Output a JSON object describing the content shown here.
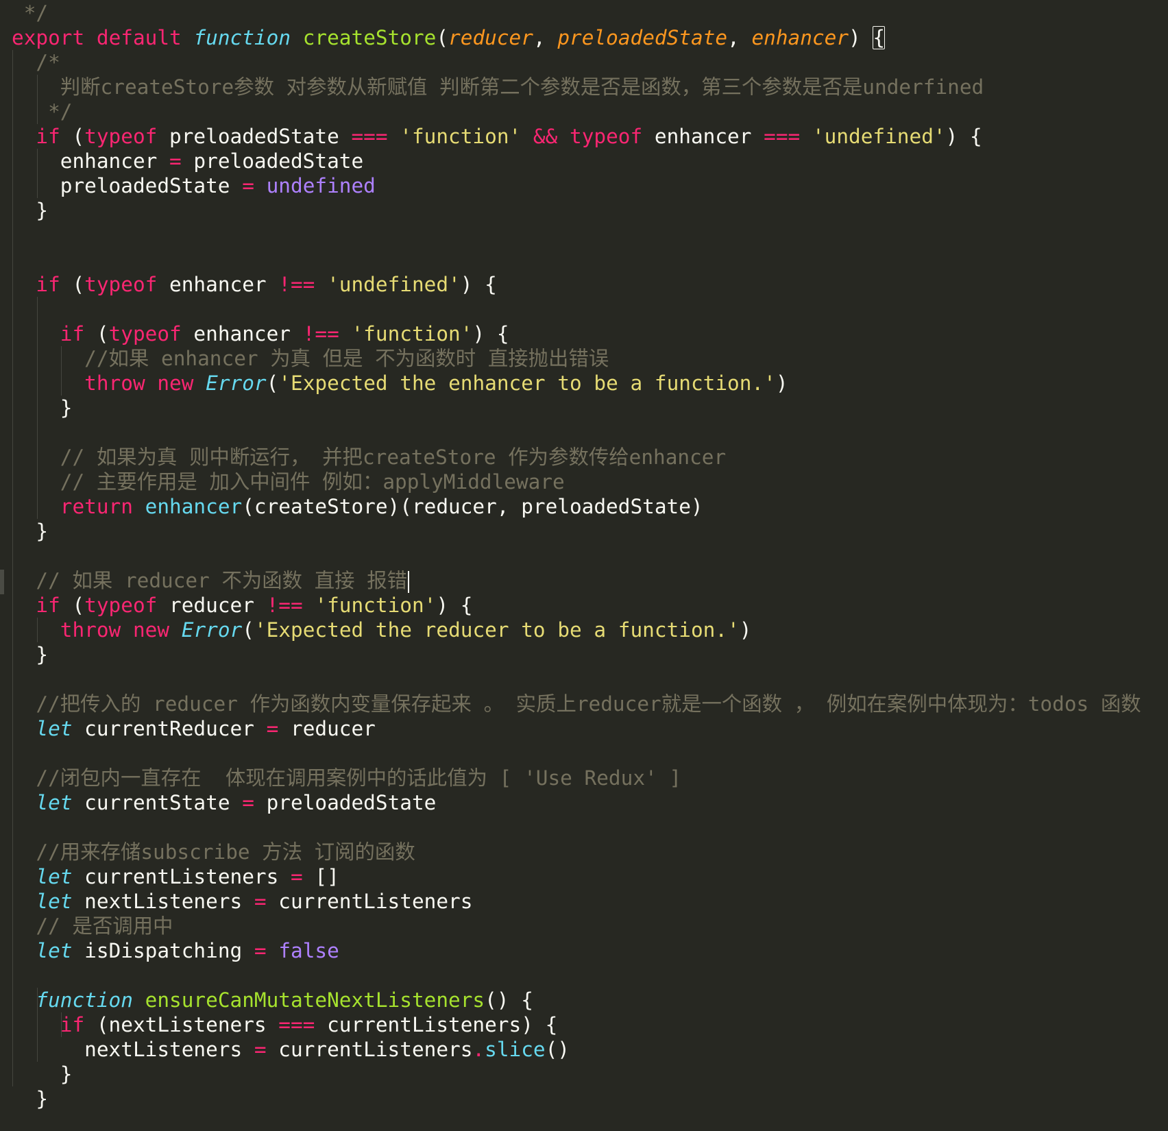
{
  "editor": {
    "theme": "Monokai",
    "colors": {
      "background": "#272822",
      "keyword": "#f92672",
      "storage": "#66d9ef",
      "function_name": "#a6e22e",
      "parameter": "#fd971f",
      "string": "#e6db74",
      "comment": "#75715e",
      "constant": "#ae81ff",
      "text": "#f8f8f2"
    },
    "cursor_line": 24,
    "lines": [
      [
        {
          "t": " */",
          "c": "comment"
        }
      ],
      [
        {
          "t": "export",
          "c": "keyword"
        },
        {
          "t": " ",
          "c": "plain"
        },
        {
          "t": "default",
          "c": "keyword"
        },
        {
          "t": " ",
          "c": "plain"
        },
        {
          "t": "function",
          "c": "storage"
        },
        {
          "t": " ",
          "c": "plain"
        },
        {
          "t": "createStore",
          "c": "funcname"
        },
        {
          "t": "(",
          "c": "plain"
        },
        {
          "t": "reducer",
          "c": "param"
        },
        {
          "t": ", ",
          "c": "plain"
        },
        {
          "t": "preloadedState",
          "c": "param"
        },
        {
          "t": ", ",
          "c": "plain"
        },
        {
          "t": "enhancer",
          "c": "param"
        },
        {
          "t": ") ",
          "c": "plain"
        },
        {
          "t": "{",
          "c": "plain",
          "m": "bracket"
        }
      ],
      [
        {
          "t": "  /*",
          "c": "comment"
        }
      ],
      [
        {
          "t": "    判断createStore参数 对参数从新赋值 判断第二个参数是否是函数，第三个参数是否是underfined",
          "c": "comment"
        }
      ],
      [
        {
          "t": "   */",
          "c": "comment"
        }
      ],
      [
        {
          "t": "  ",
          "c": "plain"
        },
        {
          "t": "if",
          "c": "keyword"
        },
        {
          "t": " (",
          "c": "plain"
        },
        {
          "t": "typeof",
          "c": "keyword"
        },
        {
          "t": " preloadedState ",
          "c": "plain"
        },
        {
          "t": "===",
          "c": "op"
        },
        {
          "t": " ",
          "c": "plain"
        },
        {
          "t": "'function'",
          "c": "string"
        },
        {
          "t": " ",
          "c": "plain"
        },
        {
          "t": "&&",
          "c": "op"
        },
        {
          "t": " ",
          "c": "plain"
        },
        {
          "t": "typeof",
          "c": "keyword"
        },
        {
          "t": " enhancer ",
          "c": "plain"
        },
        {
          "t": "===",
          "c": "op"
        },
        {
          "t": " ",
          "c": "plain"
        },
        {
          "t": "'undefined'",
          "c": "string"
        },
        {
          "t": ") {",
          "c": "plain"
        }
      ],
      [
        {
          "t": "    enhancer ",
          "c": "plain"
        },
        {
          "t": "=",
          "c": "op"
        },
        {
          "t": " preloadedState",
          "c": "plain"
        }
      ],
      [
        {
          "t": "    preloadedState ",
          "c": "plain"
        },
        {
          "t": "=",
          "c": "op"
        },
        {
          "t": " ",
          "c": "plain"
        },
        {
          "t": "undefined",
          "c": "constant"
        }
      ],
      [
        {
          "t": "  }",
          "c": "plain"
        }
      ],
      [],
      [],
      [
        {
          "t": "  ",
          "c": "plain"
        },
        {
          "t": "if",
          "c": "keyword"
        },
        {
          "t": " (",
          "c": "plain"
        },
        {
          "t": "typeof",
          "c": "keyword"
        },
        {
          "t": " enhancer ",
          "c": "plain"
        },
        {
          "t": "!==",
          "c": "op"
        },
        {
          "t": " ",
          "c": "plain"
        },
        {
          "t": "'undefined'",
          "c": "string"
        },
        {
          "t": ") {",
          "c": "plain"
        }
      ],
      [],
      [
        {
          "t": "    ",
          "c": "plain"
        },
        {
          "t": "if",
          "c": "keyword"
        },
        {
          "t": " (",
          "c": "plain"
        },
        {
          "t": "typeof",
          "c": "keyword"
        },
        {
          "t": " enhancer ",
          "c": "plain"
        },
        {
          "t": "!==",
          "c": "op"
        },
        {
          "t": " ",
          "c": "plain"
        },
        {
          "t": "'function'",
          "c": "string"
        },
        {
          "t": ") {",
          "c": "plain"
        }
      ],
      [
        {
          "t": "      //如果 enhancer 为真 但是 不为函数时 直接抛出错误",
          "c": "comment"
        }
      ],
      [
        {
          "t": "      ",
          "c": "plain"
        },
        {
          "t": "throw",
          "c": "keyword"
        },
        {
          "t": " ",
          "c": "plain"
        },
        {
          "t": "new",
          "c": "keyword"
        },
        {
          "t": " ",
          "c": "plain"
        },
        {
          "t": "Error",
          "c": "type"
        },
        {
          "t": "(",
          "c": "plain"
        },
        {
          "t": "'Expected the enhancer to be a function.'",
          "c": "string"
        },
        {
          "t": ")",
          "c": "plain"
        }
      ],
      [
        {
          "t": "    }",
          "c": "plain"
        }
      ],
      [],
      [
        {
          "t": "    // 如果为真 则中断运行， 并把createStore 作为参数传给enhancer",
          "c": "comment"
        }
      ],
      [
        {
          "t": "    // 主要作用是 加入中间件 例如：applyMiddleware",
          "c": "comment"
        }
      ],
      [
        {
          "t": "    ",
          "c": "plain"
        },
        {
          "t": "return",
          "c": "keyword"
        },
        {
          "t": " ",
          "c": "plain"
        },
        {
          "t": "enhancer",
          "c": "support"
        },
        {
          "t": "(createStore)(reducer, preloadedState)",
          "c": "plain"
        }
      ],
      [
        {
          "t": "  }",
          "c": "plain"
        }
      ],
      [],
      [
        {
          "t": "  // 如果 reducer 不为函数 直接 报错",
          "c": "comment"
        },
        {
          "t": "",
          "c": "plain",
          "m": "cursor"
        }
      ],
      [
        {
          "t": "  ",
          "c": "plain"
        },
        {
          "t": "if",
          "c": "keyword"
        },
        {
          "t": " (",
          "c": "plain"
        },
        {
          "t": "typeof",
          "c": "keyword"
        },
        {
          "t": " reducer ",
          "c": "plain"
        },
        {
          "t": "!==",
          "c": "op"
        },
        {
          "t": " ",
          "c": "plain"
        },
        {
          "t": "'function'",
          "c": "string"
        },
        {
          "t": ") {",
          "c": "plain"
        }
      ],
      [
        {
          "t": "    ",
          "c": "plain"
        },
        {
          "t": "throw",
          "c": "keyword"
        },
        {
          "t": " ",
          "c": "plain"
        },
        {
          "t": "new",
          "c": "keyword"
        },
        {
          "t": " ",
          "c": "plain"
        },
        {
          "t": "Error",
          "c": "type"
        },
        {
          "t": "(",
          "c": "plain"
        },
        {
          "t": "'Expected the reducer to be a function.'",
          "c": "string"
        },
        {
          "t": ")",
          "c": "plain"
        }
      ],
      [
        {
          "t": "  }",
          "c": "plain"
        }
      ],
      [],
      [
        {
          "t": "  //把传入的 reducer 作为函数内变量保存起来 。 实质上reducer就是一个函数 ， 例如在案例中体现为：todos 函数",
          "c": "comment"
        }
      ],
      [
        {
          "t": "  ",
          "c": "plain"
        },
        {
          "t": "let",
          "c": "storage"
        },
        {
          "t": " currentReducer ",
          "c": "plain"
        },
        {
          "t": "=",
          "c": "op"
        },
        {
          "t": " reducer",
          "c": "plain"
        }
      ],
      [],
      [
        {
          "t": "  //闭包内一直存在  体现在调用案例中的话此值为 [ 'Use Redux' ]",
          "c": "comment"
        }
      ],
      [
        {
          "t": "  ",
          "c": "plain"
        },
        {
          "t": "let",
          "c": "storage"
        },
        {
          "t": " currentState ",
          "c": "plain"
        },
        {
          "t": "=",
          "c": "op"
        },
        {
          "t": " preloadedState",
          "c": "plain"
        }
      ],
      [],
      [
        {
          "t": "  //用来存储subscribe 方法 订阅的函数",
          "c": "comment"
        }
      ],
      [
        {
          "t": "  ",
          "c": "plain"
        },
        {
          "t": "let",
          "c": "storage"
        },
        {
          "t": " currentListeners ",
          "c": "plain"
        },
        {
          "t": "=",
          "c": "op"
        },
        {
          "t": " []",
          "c": "plain"
        }
      ],
      [
        {
          "t": "  ",
          "c": "plain"
        },
        {
          "t": "let",
          "c": "storage"
        },
        {
          "t": " nextListeners ",
          "c": "plain"
        },
        {
          "t": "=",
          "c": "op"
        },
        {
          "t": " currentListeners",
          "c": "plain"
        }
      ],
      [
        {
          "t": "  // 是否调用中",
          "c": "comment"
        }
      ],
      [
        {
          "t": "  ",
          "c": "plain"
        },
        {
          "t": "let",
          "c": "storage"
        },
        {
          "t": " isDispatching ",
          "c": "plain"
        },
        {
          "t": "=",
          "c": "op"
        },
        {
          "t": " ",
          "c": "plain"
        },
        {
          "t": "false",
          "c": "constant"
        }
      ],
      [],
      [
        {
          "t": "  ",
          "c": "plain"
        },
        {
          "t": "function",
          "c": "storage"
        },
        {
          "t": " ",
          "c": "plain"
        },
        {
          "t": "ensureCanMutateNextListeners",
          "c": "funcname"
        },
        {
          "t": "() {",
          "c": "plain"
        }
      ],
      [
        {
          "t": "    ",
          "c": "plain"
        },
        {
          "t": "if",
          "c": "keyword"
        },
        {
          "t": " (nextListeners ",
          "c": "plain"
        },
        {
          "t": "===",
          "c": "op"
        },
        {
          "t": " currentListeners) {",
          "c": "plain"
        }
      ],
      [
        {
          "t": "      nextListeners ",
          "c": "plain"
        },
        {
          "t": "=",
          "c": "op"
        },
        {
          "t": " currentListeners",
          "c": "plain"
        },
        {
          "t": ".",
          "c": "op"
        },
        {
          "t": "slice",
          "c": "support"
        },
        {
          "t": "()",
          "c": "plain"
        }
      ],
      [
        {
          "t": "    }",
          "c": "plain"
        }
      ],
      [
        {
          "t": "  }",
          "c": "plain"
        }
      ]
    ]
  }
}
